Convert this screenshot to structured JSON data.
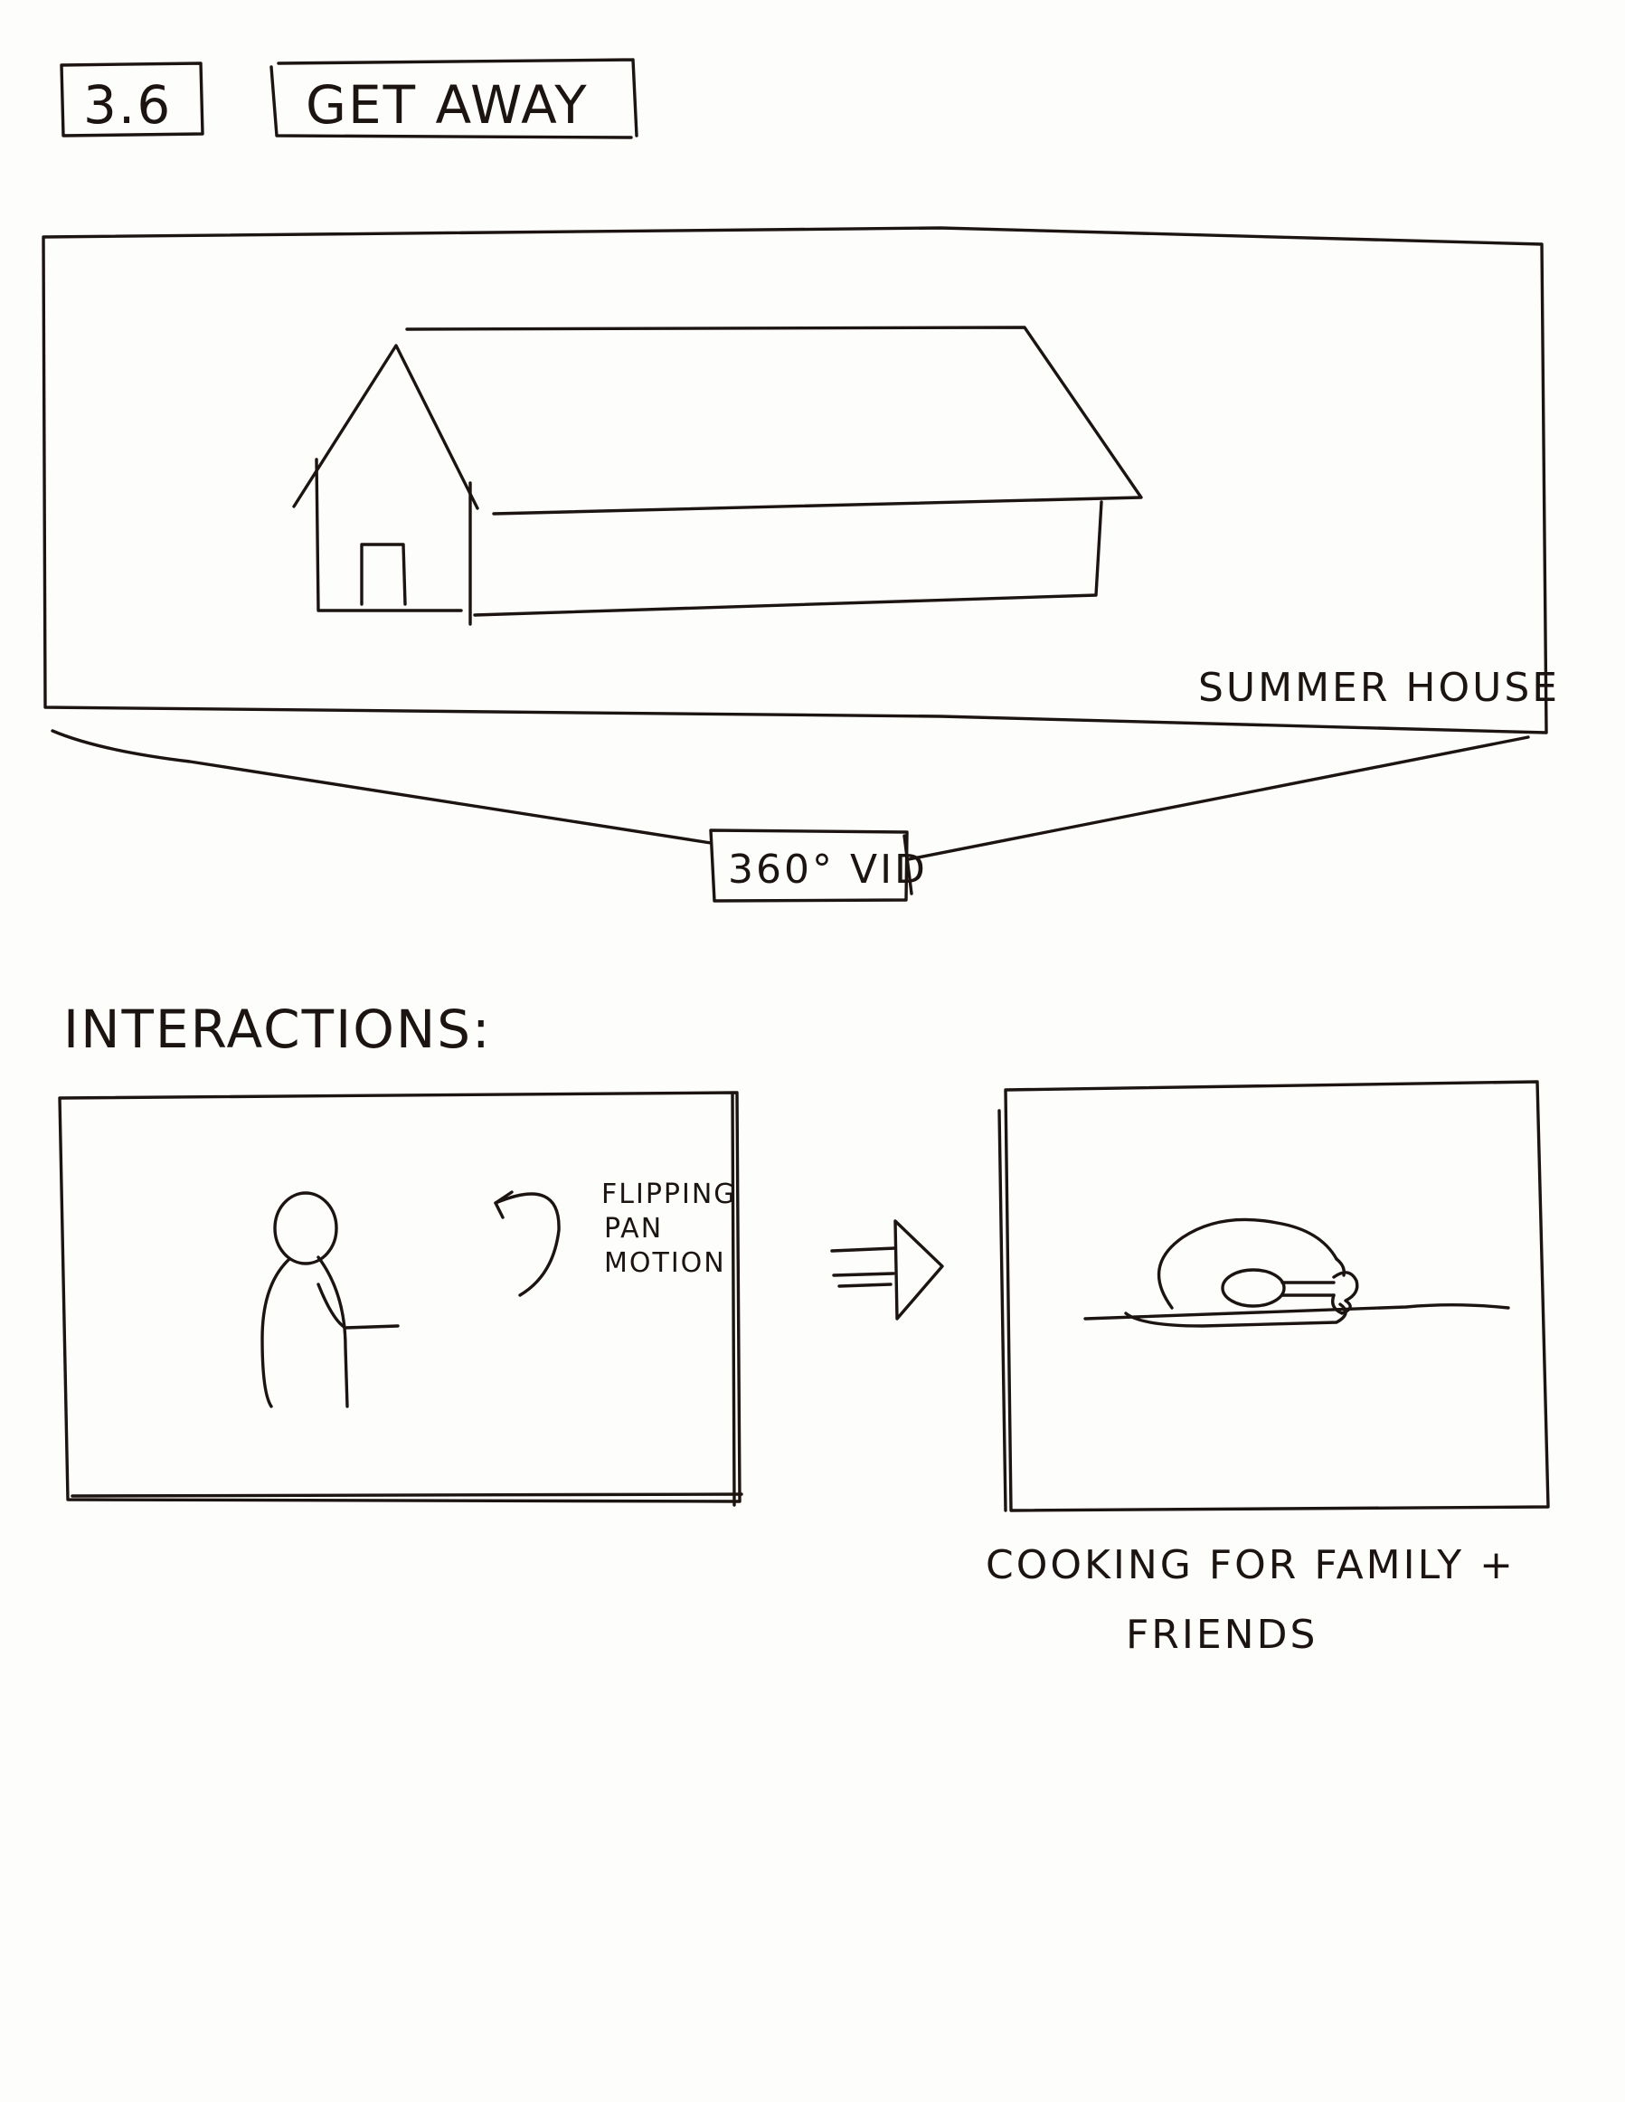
{
  "header": {
    "section_number": "3.6",
    "title": "GET AWAY"
  },
  "scene": {
    "caption": "SUMMER HOUSE",
    "media_tag": "360° VID"
  },
  "interactions": {
    "heading": "INTERACTIONS:",
    "gesture_label": [
      "FLIPPING",
      "PAN",
      "MOTION"
    ],
    "result_caption": [
      "COOKING FOR FAMILY +",
      "FRIENDS"
    ]
  }
}
